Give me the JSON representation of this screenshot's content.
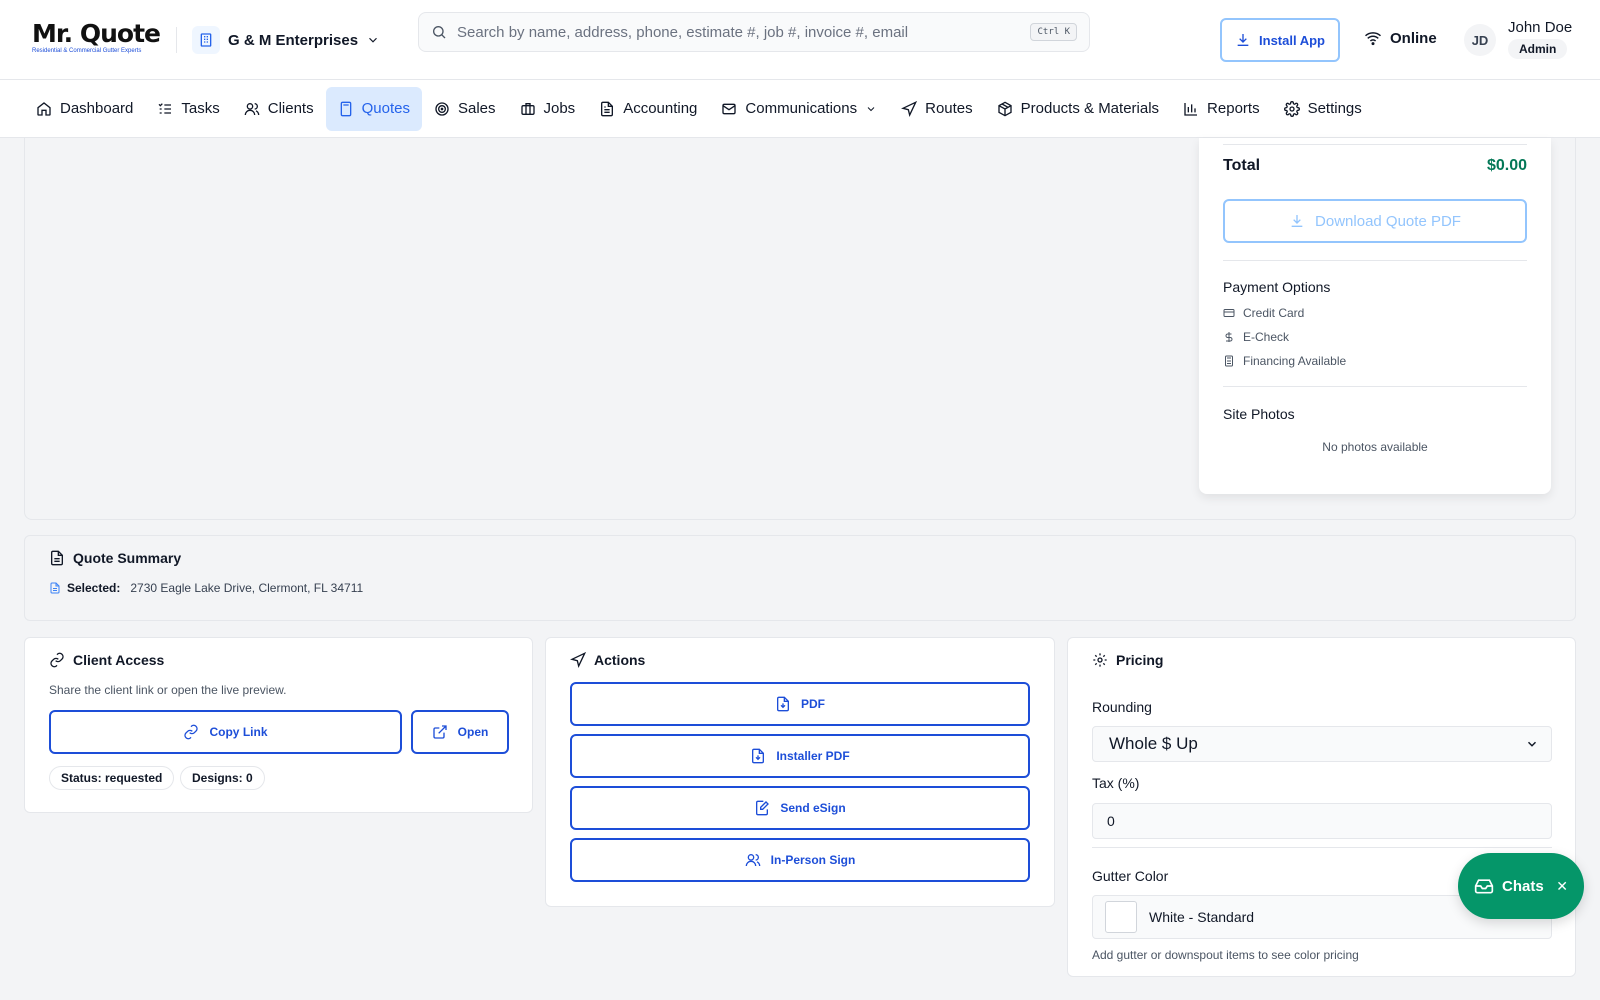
{
  "brand": {
    "title": "Mr. Quote",
    "tagline": "Residential & Commercial Gutter Experts"
  },
  "company": {
    "name": "G & M Enterprises"
  },
  "search": {
    "placeholder": "Search by name, address, phone, estimate #, job #, invoice #, email",
    "shortcut": "Ctrl K"
  },
  "header": {
    "install_label": "Install App",
    "status_label": "Online"
  },
  "user": {
    "initials": "JD",
    "name": "John Doe",
    "role": "Admin"
  },
  "nav": {
    "items": [
      {
        "label": "Dashboard",
        "icon": "home-icon"
      },
      {
        "label": "Tasks",
        "icon": "list-check-icon"
      },
      {
        "label": "Clients",
        "icon": "users-icon"
      },
      {
        "label": "Quotes",
        "icon": "calculator-icon",
        "active": true
      },
      {
        "label": "Sales",
        "icon": "target-icon"
      },
      {
        "label": "Jobs",
        "icon": "briefcase-icon"
      },
      {
        "label": "Accounting",
        "icon": "file-text-icon"
      },
      {
        "label": "Communications",
        "icon": "mail-icon"
      },
      {
        "label": "Routes",
        "icon": "navigation-icon"
      },
      {
        "label": "Products & Materials",
        "icon": "package-icon"
      },
      {
        "label": "Reports",
        "icon": "bar-chart-icon"
      },
      {
        "label": "Settings",
        "icon": "gear-icon"
      }
    ]
  },
  "quote_panel": {
    "total_label": "Total",
    "total_value": "$0.00",
    "download_label": "Download Quote PDF",
    "payment_title": "Payment Options",
    "payment_options": [
      "Credit Card",
      "E-Check",
      "Financing Available"
    ],
    "photos_title": "Site Photos",
    "photos_empty": "No photos available"
  },
  "summary": {
    "title": "Quote Summary",
    "selected_label": "Selected:",
    "selected_value": "2730 Eagle Lake Drive, Clermont, FL 34711"
  },
  "client_access": {
    "title": "Client Access",
    "description": "Share the client link or open the live preview.",
    "copy_label": "Copy Link",
    "open_label": "Open",
    "status_badge": "Status: requested",
    "designs_badge": "Designs: 0"
  },
  "actions": {
    "title": "Actions",
    "buttons": [
      "PDF",
      "Installer PDF",
      "Send eSign",
      "In-Person Sign"
    ]
  },
  "pricing": {
    "title": "Pricing",
    "rounding_label": "Rounding",
    "rounding_value": "Whole $ Up",
    "tax_label": "Tax (%)",
    "tax_value": "0",
    "gutter_label": "Gutter Color",
    "gutter_value": "White - Standard",
    "gutter_swatch": "#ffffff",
    "gutter_hint": "Add gutter or downspout items to see color pricing"
  },
  "chat": {
    "label": "Chats"
  },
  "colors": {
    "primary": "#1d4ed8",
    "success": "#047857",
    "chat": "#059669"
  }
}
